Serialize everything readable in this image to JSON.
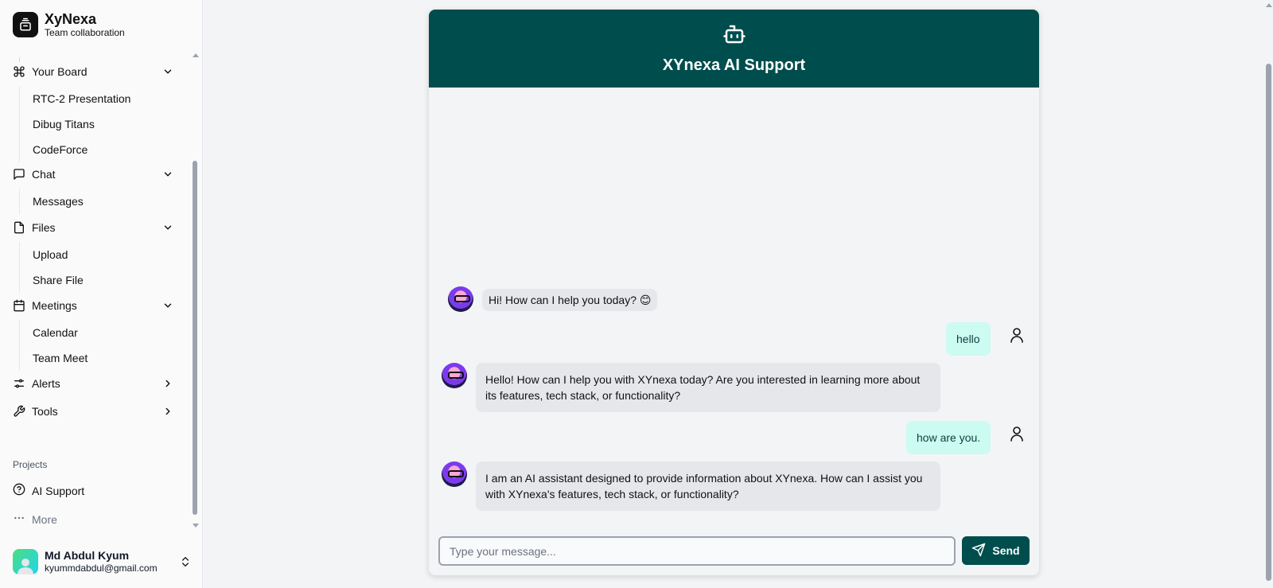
{
  "brand": {
    "name": "XyNexa",
    "subtitle": "Team collaboration"
  },
  "nav": {
    "groups": [
      {
        "label": "Your Board",
        "icon": "command-icon",
        "expanded": true,
        "items": [
          "RTC-2 Presentation",
          "Dibug Titans",
          "CodeForce"
        ]
      },
      {
        "label": "Chat",
        "icon": "message-square-icon",
        "expanded": true,
        "items": [
          "Messages"
        ]
      },
      {
        "label": "Files",
        "icon": "file-icon",
        "expanded": true,
        "items": [
          "Upload",
          "Share File"
        ]
      },
      {
        "label": "Meetings",
        "icon": "calendar-icon",
        "expanded": true,
        "items": [
          "Calendar",
          "Team Meet"
        ]
      },
      {
        "label": "Alerts",
        "icon": "sliders-icon",
        "expanded": false,
        "items": []
      },
      {
        "label": "Tools",
        "icon": "wrench-icon",
        "expanded": false,
        "items": []
      }
    ]
  },
  "projects": {
    "section_label": "Projects",
    "items": [
      {
        "label": "AI Support",
        "icon": "help-circle-icon"
      },
      {
        "label": "More",
        "icon": "more-horizontal-icon"
      }
    ]
  },
  "user": {
    "name": "Md Abdul Kyum",
    "email": "kyummdabdul@gmail.com"
  },
  "chat": {
    "title": "XYnexa AI Support",
    "header_icon": "bot-icon",
    "messages": [
      {
        "role": "bot",
        "text": "Hi! How can I help you today? 😊"
      },
      {
        "role": "user",
        "text": "hello"
      },
      {
        "role": "bot",
        "text": "Hello! How can I help you with XYnexa today? Are you interested in learning more about its features, tech stack, or functionality?"
      },
      {
        "role": "user",
        "text": "how are you."
      },
      {
        "role": "bot",
        "text": "I am an AI assistant designed to provide information about XYnexa. How can I assist you with XYnexa's features, tech stack, or functionality?"
      }
    ],
    "input": {
      "placeholder": "Type your message...",
      "value": ""
    },
    "send_label": "Send"
  },
  "colors": {
    "header_bg": "#004d4d",
    "user_bubble": "#ccfbf1",
    "bot_bubble": "#e5e7eb"
  }
}
